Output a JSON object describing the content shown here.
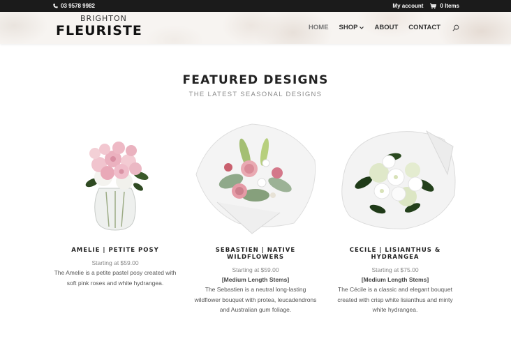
{
  "topbar": {
    "phone": "03 9578 9982",
    "account": "My account",
    "cart": "0 Items"
  },
  "logo": {
    "small": "BRIGHTON",
    "big": "FLEURISTE"
  },
  "nav": {
    "home": "HOME",
    "shop": "SHOP",
    "about": "ABOUT",
    "contact": "CONTACT"
  },
  "section": {
    "title": "FEATURED DESIGNS",
    "subtitle": "THE LATEST SEASONAL DESIGNS"
  },
  "products": [
    {
      "name": "AMELIE | PETITE POSY",
      "price": "Starting at $59.00",
      "stems": "",
      "description": "The Amelie is a petite pastel posy created with soft pink roses and white hydrangea."
    },
    {
      "name": "SEBASTIEN | NATIVE WILDFLOWERS",
      "price": "Starting at $59.00",
      "stems": "[Medium Length Stems]",
      "description": "The Sebastien is a neutral long-lasting wildflower bouquet with protea, leucadendrons and Australian gum foliage."
    },
    {
      "name": "CECILE | LISIANTHUS & HYDRANGEA",
      "price": "Starting at $75.00",
      "stems": "[Medium Length Stems]",
      "description": "The Cécile is a classic and elegant bouquet created with crisp white lisianthus and minty white hydrangea."
    }
  ],
  "icons": {
    "phone": "phone-icon",
    "cart": "cart-icon",
    "search": "search-icon",
    "chevron": "chevron-down-icon"
  },
  "colors": {
    "topbar_bg": "#1b1b1b",
    "text_dark": "#222222",
    "text_muted": "#8a8a8a"
  }
}
